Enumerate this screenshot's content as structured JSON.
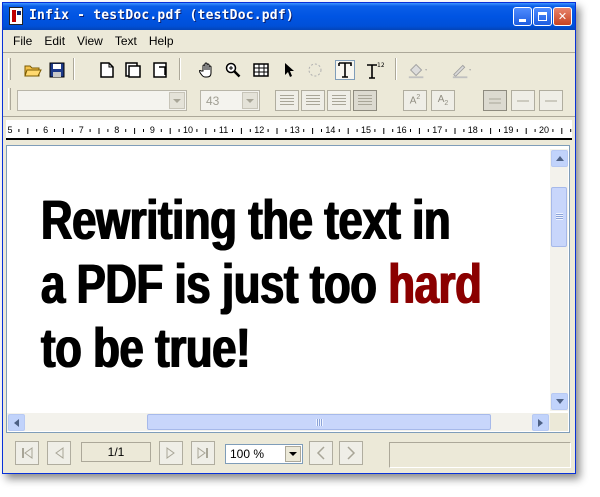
{
  "window": {
    "title": "Infix - testDoc.pdf (testDoc.pdf)"
  },
  "menu": {
    "items": [
      "File",
      "Edit",
      "View",
      "Text",
      "Help"
    ]
  },
  "toolbar": {
    "icons": [
      "open-folder-icon",
      "save-disk-icon",
      "new-page-icon",
      "pages-icon",
      "page-export-icon",
      "hand-icon",
      "zoom-icon",
      "grid-icon",
      "pointer-icon",
      "lasso-icon",
      "text-tool-icon",
      "text-flow-icon",
      "fill-color-icon",
      "line-color-icon"
    ],
    "font_size": "43",
    "superscript_label": "A",
    "superscript_mark": "2",
    "subscript_label": "A",
    "subscript_mark": "2"
  },
  "ruler": {
    "labels": [
      "5",
      "6",
      "7",
      "8",
      "9",
      "10",
      "11",
      "12",
      "13",
      "14",
      "15",
      "16",
      "17",
      "18",
      "19",
      "20"
    ]
  },
  "document": {
    "line1": "Rewriting the text in",
    "line2_start": "a PDF is just too ",
    "line2_highlight": "hard",
    "line3": "to be true!",
    "highlight_color": "#8b0000"
  },
  "navigation": {
    "page_indicator": "1/1",
    "zoom_level": "100 %"
  },
  "colors": {
    "titlebar": "#0054e3",
    "window_bg": "#ece9d8",
    "scrollbar": "#c8d6fb"
  }
}
